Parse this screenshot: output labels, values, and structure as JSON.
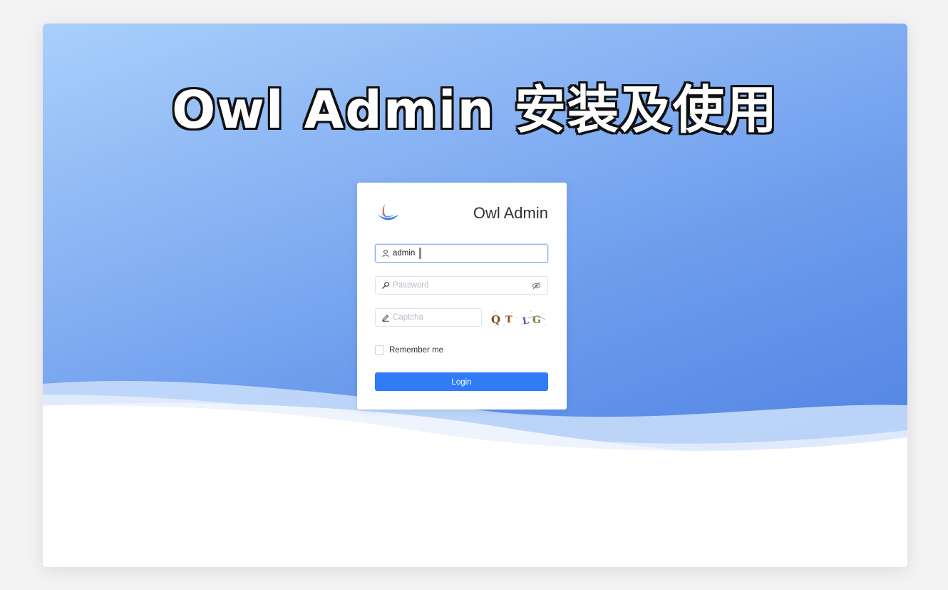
{
  "headline": "Owl Admin 安装及使用",
  "login_card": {
    "brand_name": "Owl Admin",
    "username": {
      "value": "admin",
      "icon": "user-icon"
    },
    "password": {
      "placeholder": "Password",
      "icon": "key-icon",
      "toggle_icon": "eye-off-icon"
    },
    "captcha": {
      "placeholder": "Captcha",
      "icon": "pencil-icon",
      "image_text": "QTLG"
    },
    "remember_label": "Remember me",
    "login_label": "Login"
  },
  "colors": {
    "primary": "#2f7cf6",
    "hero_top": "#a9d0fb",
    "hero_bottom": "#4f82e3"
  }
}
